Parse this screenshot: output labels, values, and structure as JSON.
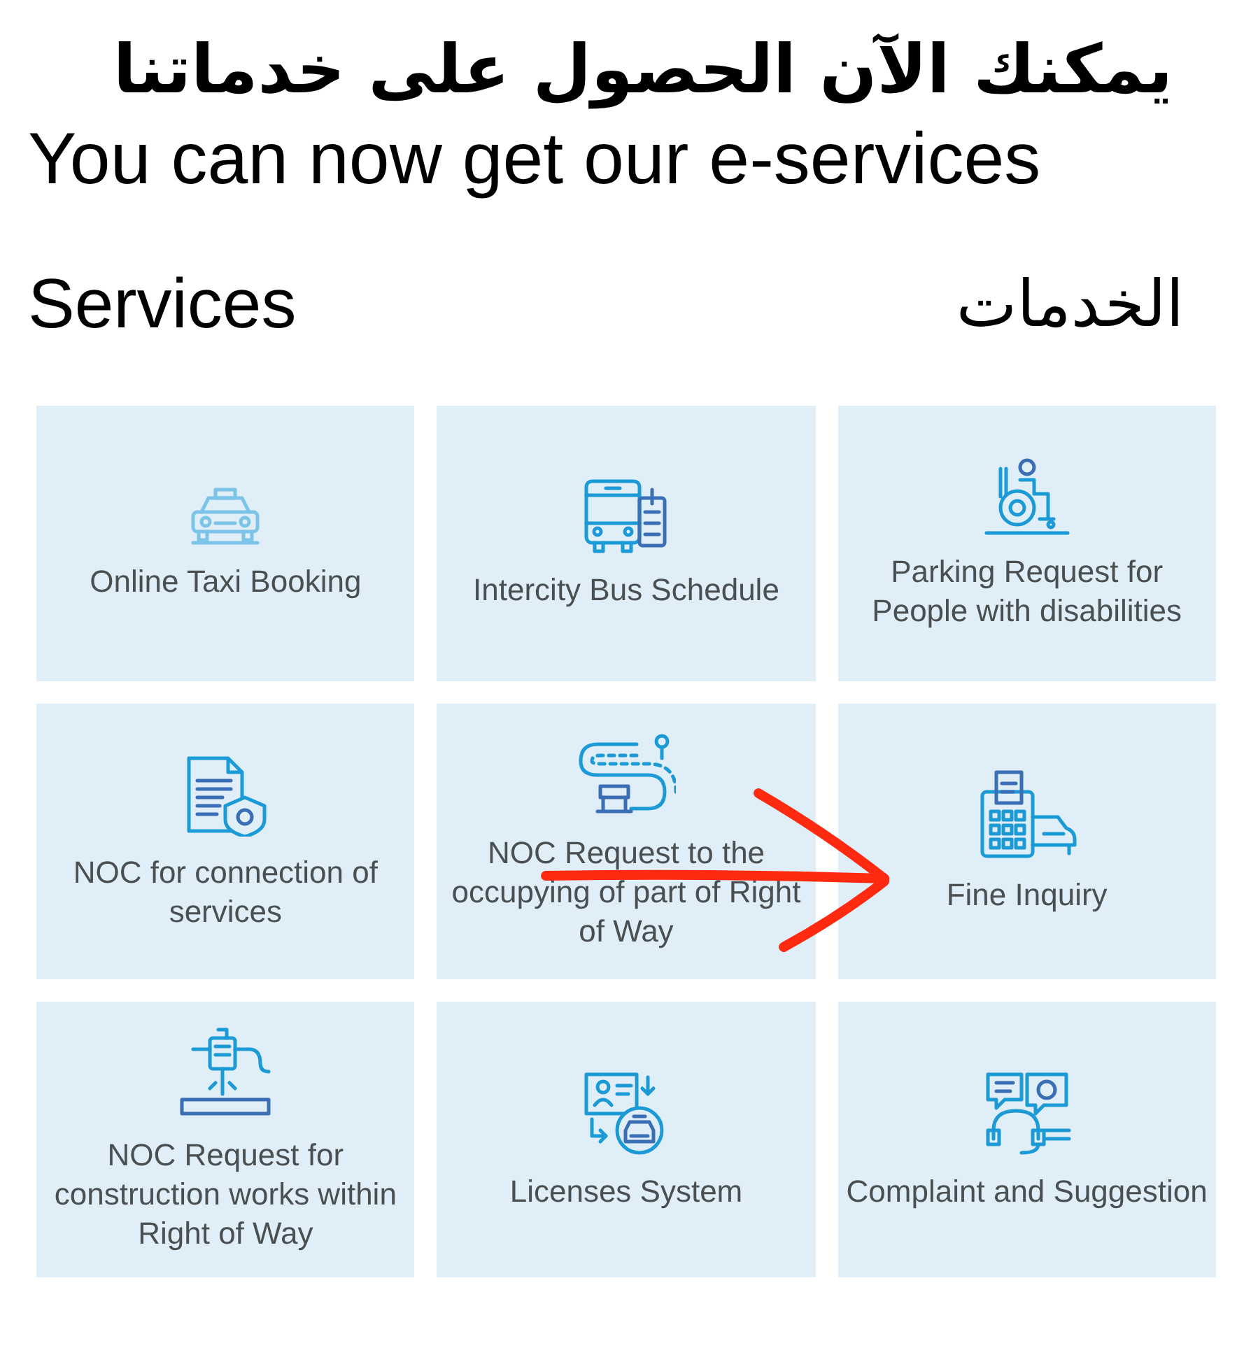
{
  "headline": {
    "arabic": "يمكنك الآن الحصول على خدماتنا",
    "english": "You can now get our e-services"
  },
  "section": {
    "title": "Services",
    "title_arabic": "الخدمات"
  },
  "services": [
    {
      "kind": "taxi",
      "label": "Online Taxi Booking"
    },
    {
      "kind": "bus",
      "label": "Intercity Bus Schedule"
    },
    {
      "kind": "wheelchair",
      "label": "Parking Request for People with disabilities"
    },
    {
      "kind": "document",
      "label": "NOC for connection of services"
    },
    {
      "kind": "road",
      "label": "NOC Request to the occupying of part of Right of Way"
    },
    {
      "kind": "fine",
      "label": "Fine Inquiry"
    },
    {
      "kind": "drill",
      "label": "NOC Request for construction works within Right of Way"
    },
    {
      "kind": "license",
      "label": "Licenses System"
    },
    {
      "kind": "support",
      "label": "Complaint and Suggestion"
    }
  ],
  "annotation": {
    "kind": "arrow"
  }
}
